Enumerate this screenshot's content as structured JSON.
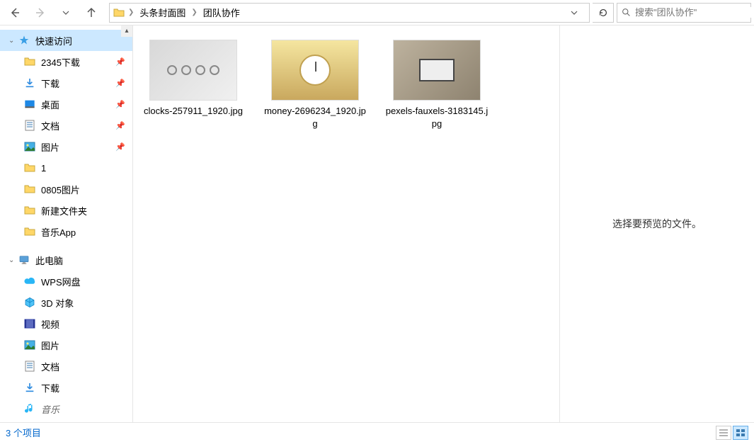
{
  "breadcrumbs": {
    "root_icon": "folder",
    "items": [
      "头条封面图",
      "团队协作"
    ]
  },
  "search": {
    "placeholder": "搜索\"团队协作\""
  },
  "sidebar": {
    "quick_access": {
      "label": "快速访问",
      "children": [
        {
          "label": "2345下载",
          "icon": "folder",
          "pinned": true
        },
        {
          "label": "下载",
          "icon": "download",
          "pinned": true
        },
        {
          "label": "桌面",
          "icon": "desktop",
          "pinned": true
        },
        {
          "label": "文档",
          "icon": "document",
          "pinned": true
        },
        {
          "label": "图片",
          "icon": "pictures",
          "pinned": true
        },
        {
          "label": "1",
          "icon": "folder",
          "pinned": false
        },
        {
          "label": "0805图片",
          "icon": "folder",
          "pinned": false
        },
        {
          "label": "新建文件夹",
          "icon": "folder",
          "pinned": false
        },
        {
          "label": "音乐App",
          "icon": "folder",
          "pinned": false
        }
      ]
    },
    "this_pc": {
      "label": "此电脑",
      "children": [
        {
          "label": "WPS网盘",
          "icon": "cloud"
        },
        {
          "label": "3D 对象",
          "icon": "3d"
        },
        {
          "label": "视频",
          "icon": "video"
        },
        {
          "label": "图片",
          "icon": "pictures"
        },
        {
          "label": "文档",
          "icon": "document"
        },
        {
          "label": "下载",
          "icon": "download"
        },
        {
          "label": "音乐",
          "icon": "music",
          "cut": true
        }
      ]
    }
  },
  "files": [
    {
      "name": "clocks-257911_1920.jpg",
      "thumb": "clocks"
    },
    {
      "name": "money-269623\n4_1920.jpg",
      "thumb": "money"
    },
    {
      "name": "pexels-fauxels-3183145.jpg",
      "thumb": "pexels"
    }
  ],
  "preview": {
    "empty_text": "选择要预览的文件。"
  },
  "status": {
    "text": "3 个项目"
  }
}
